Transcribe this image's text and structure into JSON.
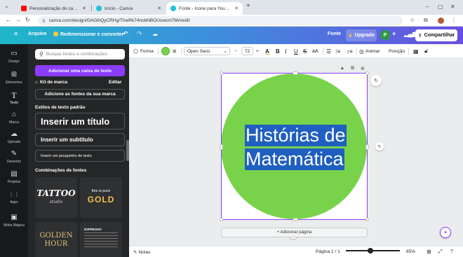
{
  "browser": {
    "tabs": [
      {
        "title": "Personalização do canal - YouTube",
        "favicon_color": "#ff0000"
      },
      {
        "title": "Início - Canva",
        "favicon_color": "#1ec4d9"
      },
      {
        "title": "Fonte - Ícone para YouTube",
        "favicon_color": "#1ec4d9"
      }
    ],
    "new_tab": "+",
    "url": "canva.com/design/DAGihQyCRHg/ThwRk74nobNBOUcwcm7MA/edit",
    "win_controls": [
      "–",
      "▢",
      "✕"
    ]
  },
  "topbar": {
    "menu_icon": "≡",
    "file": "Arquivo",
    "resize": "Redimensionar e converter",
    "font": "Fonte",
    "upgrade": "Upgrade",
    "avatar_initial": "P",
    "share": "Compartilhar"
  },
  "rail": [
    {
      "icon": "▭",
      "label": "Design"
    },
    {
      "icon": "⊞",
      "label": "Elementos"
    },
    {
      "icon": "T",
      "label": "Texto"
    },
    {
      "icon": "⌂",
      "label": "Marca"
    },
    {
      "icon": "☁",
      "label": "Uploads"
    },
    {
      "icon": "✎",
      "label": "Desenho"
    },
    {
      "icon": "▤",
      "label": "Projetos"
    },
    {
      "icon": "⋮⋮",
      "label": "Apps"
    },
    {
      "icon": "▣",
      "label": "Mídia Mágica"
    }
  ],
  "panel": {
    "search_placeholder": "Busque fontes e combinações",
    "add_text_box": "Adicionar uma caixa de texto",
    "brand_kit": "Kit de marca",
    "edit": "Editar",
    "add_brand_fonts": "Adicione as fontes da sua marca",
    "default_styles": "Estilos de texto padrão",
    "heading": "Inserir um título",
    "subheading": "Inserir um subtítulo",
    "body": "Inserir um pouquinho de texto",
    "combos": "Combinações de fontes",
    "tile1_main": "TATTOO",
    "tile1_sub": "studio",
    "tile2_top": "this is pure",
    "tile2_main": "GOLD",
    "tile3_main": "GOLDEN",
    "tile3_sub": "HOUR",
    "tile4_title": "ESPRESSO"
  },
  "toolbar": {
    "shape": "Forma",
    "font_family": "Open Sans",
    "font_size": "72",
    "animate": "Animar",
    "position": "Posição",
    "fill_color": "#78d34b"
  },
  "canvas": {
    "line1": "Histórias de",
    "line2": "Matemática",
    "add_page": "+ Adicionar página",
    "circle_color": "#78d34b",
    "highlight_color": "#1f5fbf"
  },
  "statusbar": {
    "notes": "Notas",
    "page": "Página 1 / 1",
    "zoom": "65%",
    "zoom_level_percent": 65
  }
}
